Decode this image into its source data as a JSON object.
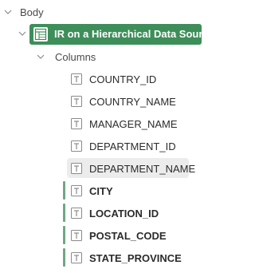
{
  "tree": {
    "body_label": "Body",
    "region_label": "IR on a Hierarchical Data Source",
    "columns_label": "Columns",
    "columns": [
      {
        "label": "COUNTRY_ID",
        "bold": false
      },
      {
        "label": "COUNTRY_NAME",
        "bold": false
      },
      {
        "label": "MANAGER_NAME",
        "bold": false
      },
      {
        "label": "DEPARTMENT_ID",
        "bold": false
      },
      {
        "label": "DEPARTMENT_NAME",
        "bold": false
      },
      {
        "label": "CITY",
        "bold": true
      },
      {
        "label": "LOCATION_ID",
        "bold": true
      },
      {
        "label": "POSTAL_CODE",
        "bold": true
      },
      {
        "label": "STATE_PROVINCE",
        "bold": true
      }
    ]
  },
  "icons": {
    "expander": "chevron-down-icon",
    "region": "interactive-report-icon",
    "column": "text-column-icon"
  },
  "colors": {
    "region_accent": "#3e8e5a",
    "selection_bar": "#6ea884",
    "hover_highlight": "#ececec"
  }
}
